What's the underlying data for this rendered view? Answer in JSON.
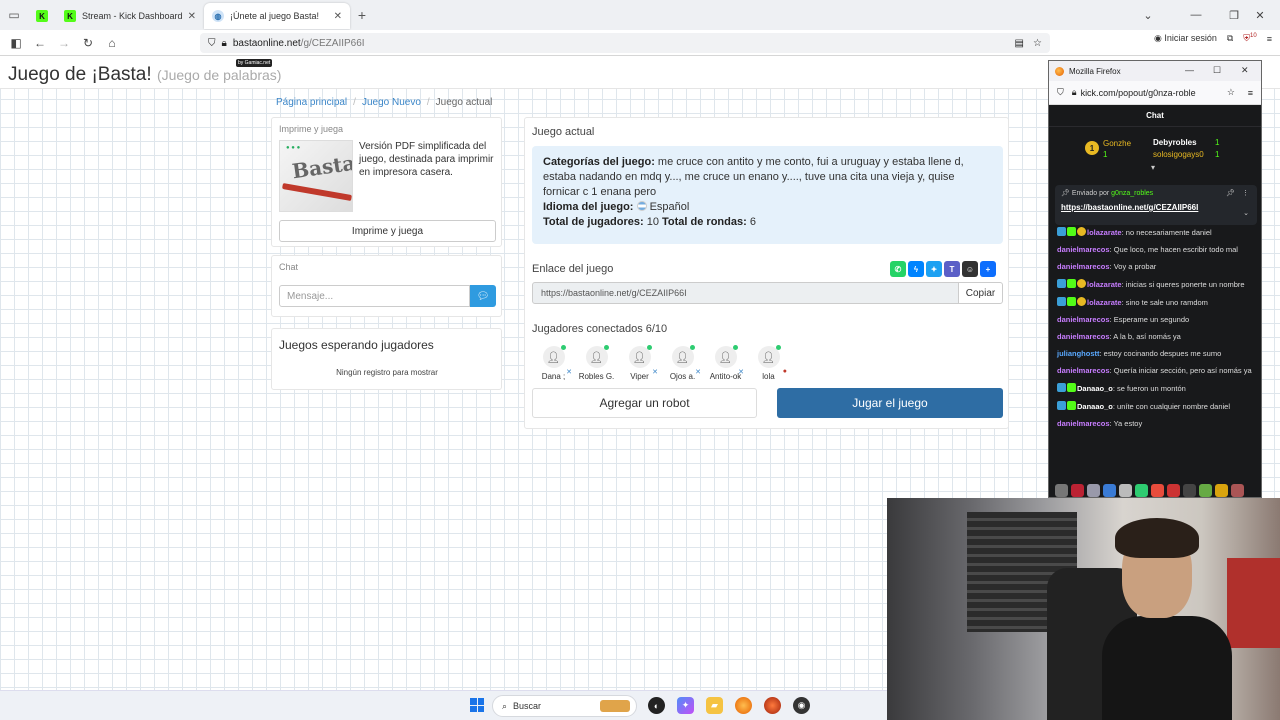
{
  "browser": {
    "tabs": [
      {
        "label": "",
        "icon": "kick-logo-icon"
      },
      {
        "label": "Stream - Kick Dashboard",
        "icon": "kick-logo-icon"
      },
      {
        "label": "¡Únete al juego Basta!",
        "icon": "globe-icon"
      }
    ],
    "url_host": "bastaonline.net",
    "url_path": "/g/CEZAIIP66I",
    "signin_label": "Iniciar sesión",
    "extension_badge": "10"
  },
  "site": {
    "title": "Juego de ¡Basta!",
    "subtitle": "(Juego de palabras)",
    "badge": "by Gamiac.net"
  },
  "breadcrumb": {
    "home": "Página principal",
    "new_game": "Juego Nuevo",
    "current": "Juego actual"
  },
  "print_panel": {
    "title": "Imprime y juega",
    "description": "Versión PDF simplificada del juego, destinada para imprimir en impresora casera.",
    "button": "Imprime y juega",
    "image_word": "Basta"
  },
  "chat_panel": {
    "title": "Chat",
    "placeholder": "Mensaje..."
  },
  "waiting_panel": {
    "title": "Juegos esperando jugadores",
    "empty": "Ningún registro para mostrar"
  },
  "game": {
    "title": "Juego actual",
    "categories_label": "Categorías del juego:",
    "categories_value": "me cruce con antito y me conto, fui a uruguay y estaba llene d, estaba nadando en mdq y..., me cruce un enano y...., tuve una cita una vieja y, quise fornicar c 1 enana pero",
    "language_label": "Idioma del juego:",
    "language_value": "Español",
    "players_total_label": "Total de jugadores:",
    "players_total_value": "10",
    "rounds_label": "Total de rondas:",
    "rounds_value": "6",
    "link_label": "Enlace del juego",
    "link_value": "https://bastaonline.net/g/CEZAIIP66I",
    "copy_button": "Copiar",
    "players_label": "Jugadores conectados 6/10",
    "players": [
      "Dana ;",
      "Robles G.",
      "Viper",
      "Ojos a.",
      "Antito-ok",
      "lola"
    ],
    "add_robot_button": "Agregar un robot",
    "play_button": "Jugar el juego",
    "share_icons": [
      "whatsapp-icon",
      "messenger-icon",
      "twitter-icon",
      "teams-icon",
      "snapchat-icon",
      "more-share-icon"
    ]
  },
  "popout": {
    "window_title": "Mozilla Firefox",
    "url": "kick.com/popout/g0nza-roble",
    "chat_title": "Chat",
    "leaders": {
      "rank": "1",
      "first_name": "Gonzhe",
      "first_count": "1",
      "second_name": "Debyrobles",
      "second_count": "1",
      "third_name": "solosigogays0",
      "third_count": "1"
    },
    "pinned_by_label": "Enviado por",
    "pinned_by": "g0nza_robles",
    "pinned_url": "https://bastaonline.net/g/CEZAIIP66I",
    "messages": [
      {
        "user": "lolazarate",
        "text": "no necesariamente daniel",
        "color": "#c77dff",
        "badges": true
      },
      {
        "user": "danielmarecos",
        "text": "Que loco, me hacen escribir todo mal",
        "color": "#c77dff",
        "badges": false
      },
      {
        "user": "danielmarecos",
        "text": "Voy a probar",
        "color": "#c77dff",
        "badges": false
      },
      {
        "user": "lolazarate",
        "text": "inicias si queres ponerte un nombre",
        "color": "#c77dff",
        "badges": true
      },
      {
        "user": "lolazarate",
        "text": "sino te sale uno ramdom",
        "color": "#c77dff",
        "badges": true
      },
      {
        "user": "danielmarecos",
        "text": "Esperame un segundo",
        "color": "#c77dff",
        "badges": false
      },
      {
        "user": "danielmarecos",
        "text": "A la b, así nomás ya",
        "color": "#c77dff",
        "badges": false
      },
      {
        "user": "julianghostt",
        "text": "estoy cocinando despues me sumo",
        "color": "#5aa9ff",
        "badges": false
      },
      {
        "user": "danielmarecos",
        "text": "Quería iniciar sección, pero así nomás ya",
        "color": "#c77dff",
        "badges": false
      },
      {
        "user": "Danaao_o",
        "text": "se fueron un montón",
        "color": "#ffffff",
        "badges": true
      },
      {
        "user": "Danaao_o",
        "text": "uníte con cualquier nombre daniel",
        "color": "#ffffff",
        "badges": true
      },
      {
        "user": "danielmarecos",
        "text": "Ya estoy",
        "color": "#c77dff",
        "badges": false
      }
    ]
  },
  "taskbar": {
    "search_label": "Buscar"
  },
  "colors": {
    "accent_blue": "#2e6da4",
    "kick_green": "#53fc18",
    "info_bg": "#e5f1fb"
  }
}
